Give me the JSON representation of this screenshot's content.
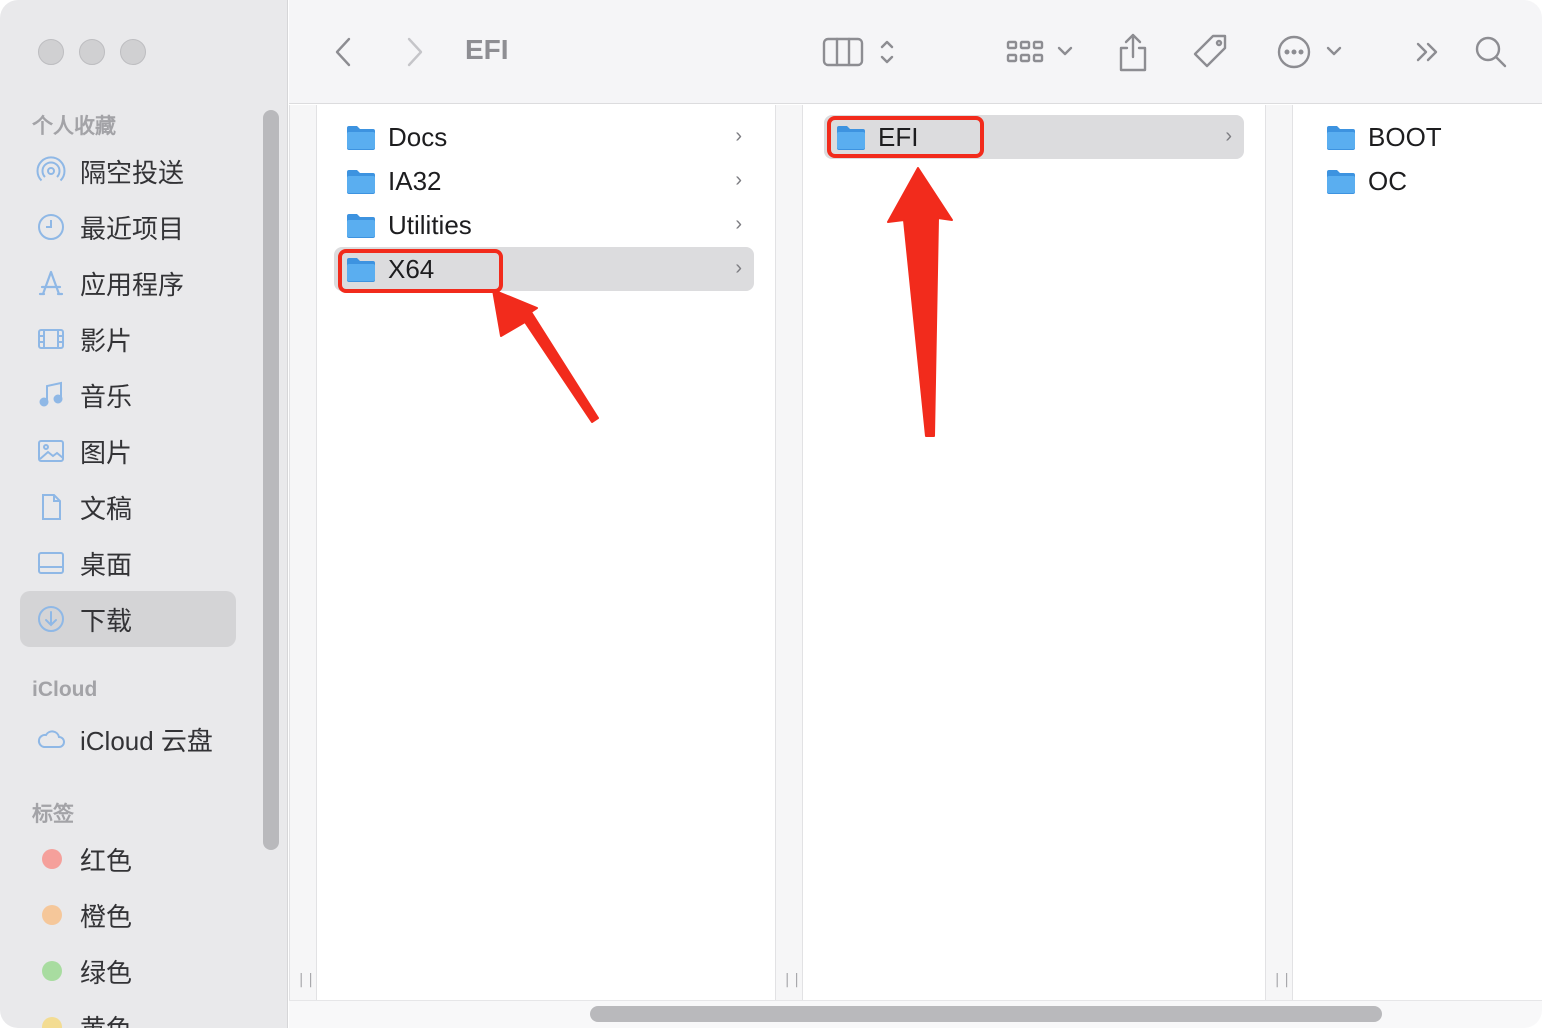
{
  "sidebar": {
    "section_favorites": "个人收藏",
    "favorites": [
      {
        "label": "隔空投送",
        "icon": "airdrop-icon"
      },
      {
        "label": "最近项目",
        "icon": "clock-icon"
      },
      {
        "label": "应用程序",
        "icon": "applications-icon"
      },
      {
        "label": "影片",
        "icon": "film-icon"
      },
      {
        "label": "音乐",
        "icon": "music-icon"
      },
      {
        "label": "图片",
        "icon": "photo-icon"
      },
      {
        "label": "文稿",
        "icon": "document-icon"
      },
      {
        "label": "桌面",
        "icon": "desktop-icon"
      },
      {
        "label": "下载",
        "icon": "download-icon",
        "selected": true
      }
    ],
    "section_icloud": "iCloud",
    "icloud": [
      {
        "label": "iCloud 云盘",
        "icon": "cloud-icon"
      }
    ],
    "section_tags": "标签",
    "tags": [
      {
        "label": "红色",
        "color": "#f5a09b"
      },
      {
        "label": "橙色",
        "color": "#f5c79a"
      },
      {
        "label": "绿色",
        "color": "#a8dca0"
      },
      {
        "label": "黄色",
        "color": "#f3dc92"
      }
    ]
  },
  "toolbar": {
    "title": "EFI",
    "icons": [
      "back-icon",
      "forward-icon",
      "column-view-icon",
      "group-icon",
      "share-icon",
      "tag-icon",
      "more-icon",
      "overflow-icon",
      "search-icon"
    ]
  },
  "columns": [
    {
      "items": [
        {
          "label": "Docs",
          "has_children": true
        },
        {
          "label": "IA32",
          "has_children": true
        },
        {
          "label": "Utilities",
          "has_children": true
        },
        {
          "label": "X64",
          "has_children": true,
          "selected": true
        }
      ]
    },
    {
      "items": [
        {
          "label": "EFI",
          "has_children": true,
          "selected": true
        }
      ]
    },
    {
      "items": [
        {
          "label": "BOOT",
          "has_children": false
        },
        {
          "label": "OC",
          "has_children": false
        }
      ]
    }
  ],
  "colors": {
    "folder": "#5aaef0",
    "annotation": "#f22b1c",
    "selection": "#dcdcde"
  }
}
